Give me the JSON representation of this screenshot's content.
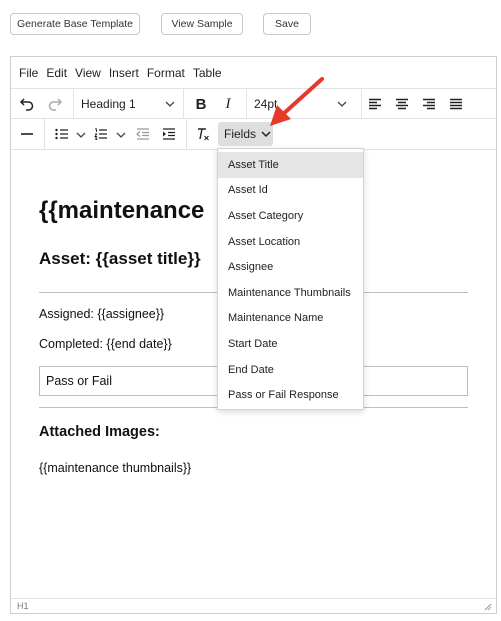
{
  "top_buttons": {
    "generate": "Generate Base Template",
    "view_sample": "View Sample",
    "save": "Save"
  },
  "menubar": [
    "File",
    "Edit",
    "View",
    "Insert",
    "Format",
    "Table"
  ],
  "toolbar": {
    "block_format": "Heading 1",
    "font_size": "24pt",
    "fields_label": "Fields"
  },
  "document": {
    "heading1": "{{maintenance",
    "heading2": "Asset: {{asset title}}",
    "assigned": "Assigned: {{assignee}}",
    "completed": "Completed: {{end date}}",
    "pass_fail_box": "Pass or Fail",
    "attached_heading": "Attached Images:",
    "thumbnails": "{{maintenance thumbnails}}"
  },
  "statusbar": {
    "path": "H1"
  },
  "fields_menu": {
    "items": [
      "Asset Title",
      "Asset Id",
      "Asset Category",
      "Asset Location",
      "Assignee",
      "Maintenance Thumbnails",
      "Maintenance Name",
      "Start Date",
      "End Date",
      "Pass or Fail Response"
    ],
    "highlighted": "Asset Title"
  },
  "colors": {
    "annotation_arrow": "#e8382a",
    "menu_highlight": "#e5e5e5",
    "fields_button_bg": "#dedede"
  }
}
